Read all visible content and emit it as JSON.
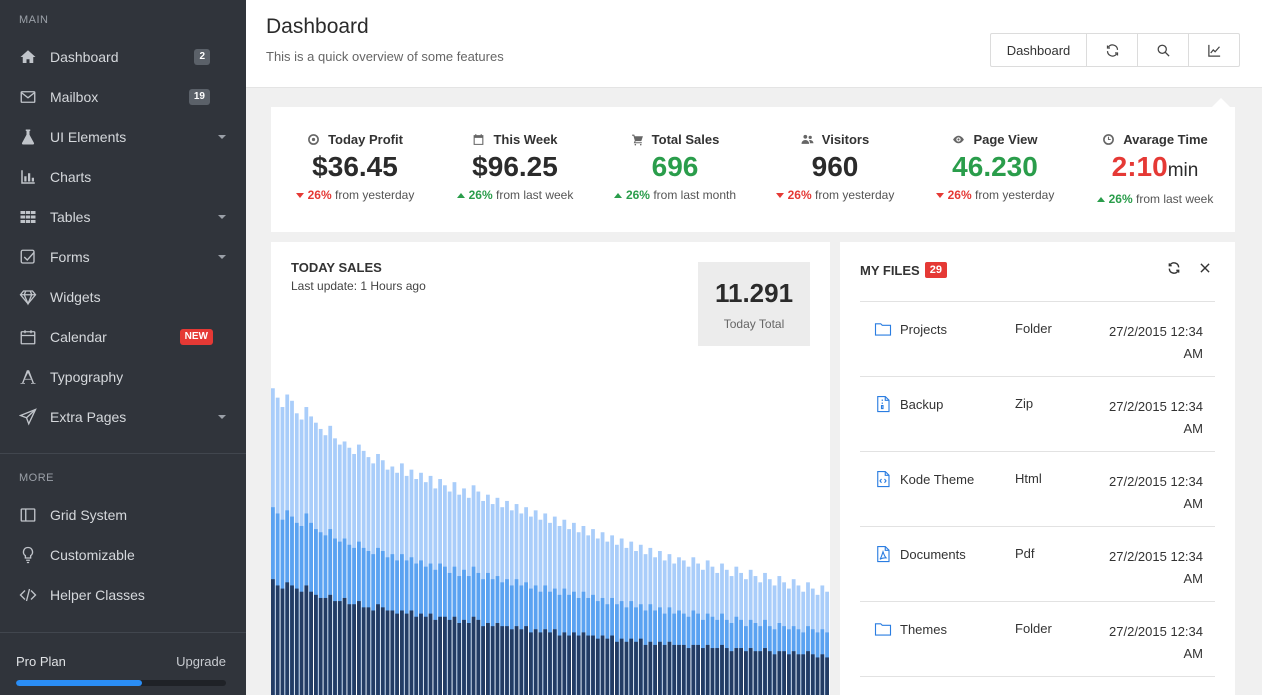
{
  "sidebar": {
    "main_title": "MAIN",
    "more_title": "MORE",
    "items": [
      {
        "label": "Dashboard",
        "badge": "2"
      },
      {
        "label": "Mailbox",
        "badge": "19"
      },
      {
        "label": "UI Elements"
      },
      {
        "label": "Charts"
      },
      {
        "label": "Tables"
      },
      {
        "label": "Forms"
      },
      {
        "label": "Widgets"
      },
      {
        "label": "Calendar",
        "badge": "NEW"
      },
      {
        "label": "Typography"
      },
      {
        "label": "Extra Pages"
      }
    ],
    "more_items": [
      {
        "label": "Grid System"
      },
      {
        "label": "Customizable"
      },
      {
        "label": "Helper Classes"
      }
    ],
    "plan": {
      "label": "Pro Plan",
      "upgrade": "Upgrade",
      "progress": 0.6
    }
  },
  "header": {
    "title": "Dashboard",
    "subtitle": "This is a quick overview of some features",
    "button_label": "Dashboard"
  },
  "stats": [
    {
      "label": "Today Profit",
      "value": "$36.45",
      "trend": "down",
      "pct": "26%",
      "text": "from yesterday"
    },
    {
      "label": "This Week",
      "value": "$96.25",
      "trend": "up",
      "pct": "26%",
      "text": "from last week"
    },
    {
      "label": "Total Sales",
      "value": "696",
      "trend": "up",
      "pct": "26%",
      "text": "from last month"
    },
    {
      "label": "Visitors",
      "value": "960",
      "trend": "down",
      "pct": "26%",
      "text": "from yesterday"
    },
    {
      "label": "Page View",
      "value": "46.230",
      "trend": "down",
      "pct": "26%",
      "text": "from yesterday"
    },
    {
      "label": "Avarage Time",
      "value": "2:10",
      "unit": "min",
      "trend": "up",
      "pct": "26%",
      "text": "from last week"
    }
  ],
  "sales": {
    "title": "TODAY SALES",
    "update": "Last update: 1 Hours ago",
    "total_value": "11.291",
    "total_label": "Today Total"
  },
  "files": {
    "title": "MY FILES",
    "count": "29",
    "rows": [
      {
        "name": "Projects",
        "type": "Folder",
        "date": "27/2/2015 12:34 AM",
        "icon": "folder-icon"
      },
      {
        "name": "Backup",
        "type": "Zip",
        "date": "27/2/2015 12:34 AM",
        "icon": "zip-file-icon"
      },
      {
        "name": "Kode Theme",
        "type": "Html",
        "date": "27/2/2015 12:34 AM",
        "icon": "code-file-icon"
      },
      {
        "name": "Documents",
        "type": "Pdf",
        "date": "27/2/2015 12:34 AM",
        "icon": "pdf-file-icon"
      },
      {
        "name": "Themes",
        "type": "Folder",
        "date": "27/2/2015 12:34 AM",
        "icon": "folder-icon"
      }
    ]
  },
  "colors": {
    "sidebar_bg": "#30343b",
    "accent_blue": "#2a8df5",
    "green": "#2a9d4b",
    "red": "#e53935",
    "chart_light": "#a9cdfa",
    "chart_mid": "#5aa2f1",
    "chart_dark": "#233c64"
  },
  "chart_data": {
    "type": "bar",
    "stacked": true,
    "series": [
      {
        "values": [
          98,
          95,
          92,
          96,
          94,
          90,
          88,
          92,
          89,
          87,
          85,
          83,
          86,
          82,
          80,
          81,
          79,
          77,
          80,
          78,
          76,
          74,
          77,
          75,
          72,
          73,
          71,
          74,
          70,
          72,
          69,
          71,
          68,
          70,
          66,
          69,
          67,
          65,
          68,
          64,
          66,
          63,
          67,
          65,
          62,
          64,
          61,
          63,
          60,
          62,
          59,
          61,
          58,
          60,
          57,
          59,
          56,
          58,
          55,
          57,
          54,
          56,
          53,
          55,
          52,
          54,
          51,
          53,
          50,
          52,
          49,
          51,
          48,
          50,
          47,
          49,
          46,
          48,
          45,
          47,
          44,
          46,
          43,
          45,
          42,
          44,
          43,
          41,
          44,
          42,
          40,
          43,
          41,
          39,
          42,
          40,
          38,
          41,
          39,
          37,
          40,
          38,
          36,
          39,
          37,
          35,
          38,
          36,
          34,
          37,
          35,
          33,
          36,
          34,
          32,
          35,
          33
        ]
      },
      {
        "values": [
          60,
          58,
          56,
          59,
          57,
          55,
          54,
          58,
          55,
          53,
          52,
          51,
          53,
          50,
          49,
          50,
          48,
          47,
          49,
          47,
          46,
          45,
          47,
          46,
          44,
          45,
          43,
          45,
          43,
          44,
          42,
          43,
          41,
          42,
          40,
          42,
          41,
          39,
          41,
          38,
          40,
          38,
          41,
          39,
          37,
          39,
          37,
          38,
          36,
          37,
          35,
          37,
          35,
          36,
          34,
          35,
          33,
          35,
          33,
          34,
          32,
          34,
          32,
          33,
          31,
          33,
          31,
          32,
          30,
          31,
          29,
          31,
          29,
          30,
          28,
          30,
          28,
          29,
          27,
          29,
          27,
          28,
          26,
          28,
          26,
          27,
          26,
          25,
          27,
          26,
          24,
          26,
          25,
          24,
          26,
          24,
          23,
          25,
          24,
          22,
          24,
          23,
          22,
          24,
          22,
          21,
          23,
          22,
          21,
          22,
          21,
          20,
          22,
          21,
          20,
          21,
          20
        ]
      },
      {
        "values": [
          37,
          35,
          34,
          36,
          35,
          34,
          33,
          35,
          33,
          32,
          31,
          31,
          32,
          30,
          30,
          31,
          29,
          29,
          30,
          28,
          28,
          27,
          29,
          28,
          27,
          27,
          26,
          27,
          26,
          27,
          25,
          26,
          25,
          26,
          24,
          25,
          25,
          24,
          25,
          23,
          24,
          23,
          25,
          24,
          22,
          23,
          22,
          23,
          22,
          22,
          21,
          22,
          21,
          22,
          20,
          21,
          20,
          21,
          20,
          21,
          19,
          20,
          19,
          20,
          19,
          20,
          19,
          19,
          18,
          19,
          18,
          19,
          17,
          18,
          17,
          18,
          17,
          18,
          16,
          17,
          16,
          17,
          16,
          17,
          16,
          16,
          16,
          15,
          16,
          16,
          15,
          16,
          15,
          15,
          16,
          15,
          14,
          15,
          15,
          14,
          15,
          14,
          14,
          15,
          14,
          13,
          14,
          14,
          13,
          14,
          13,
          13,
          14,
          13,
          12,
          13,
          12
        ]
      }
    ]
  }
}
